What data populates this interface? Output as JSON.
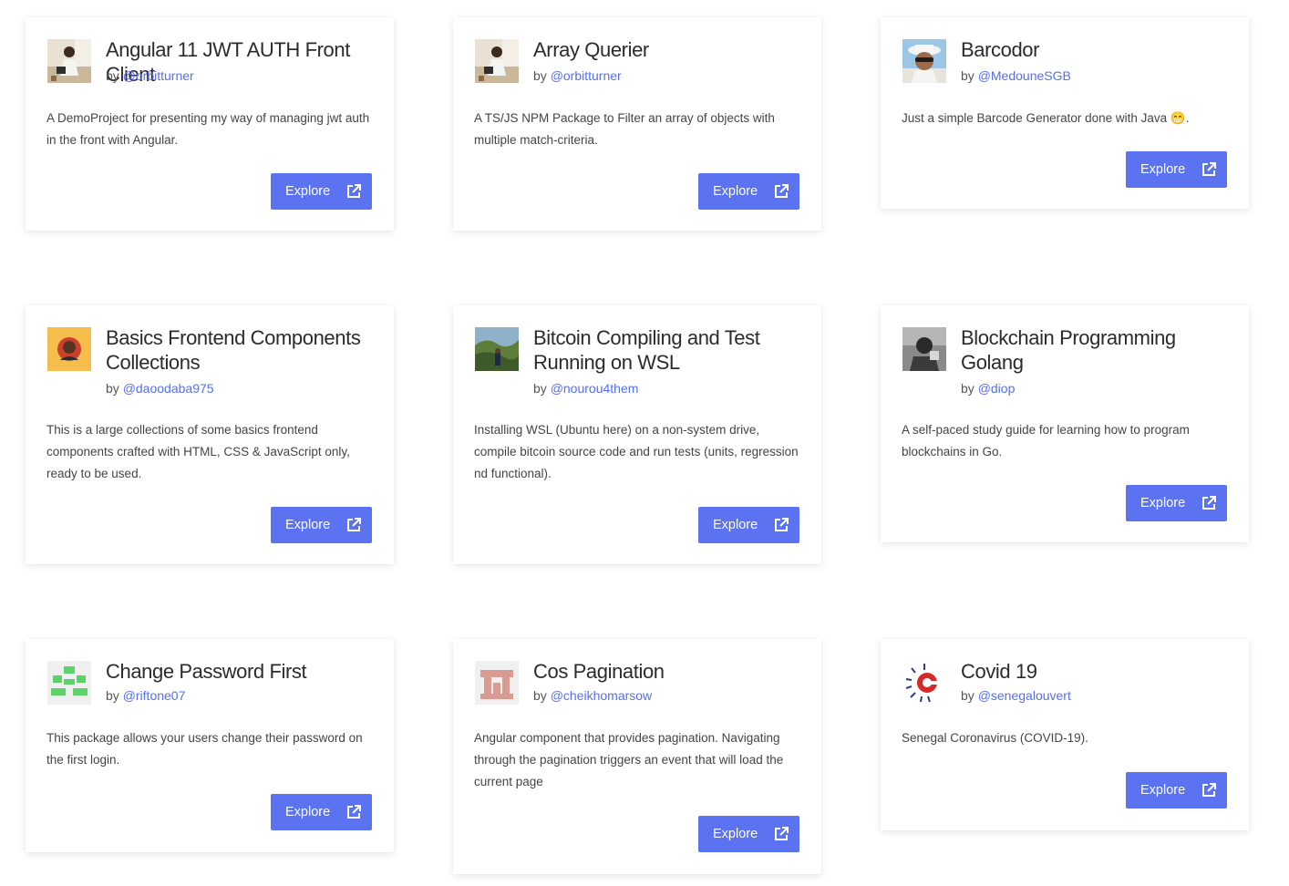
{
  "explore_label": "Explore",
  "accent_color": "#5b73f0",
  "cards": [
    {
      "title": "Angular 11 JWT AUTH Front Client",
      "by": "by",
      "handle": "@orbitturner",
      "description": "A DemoProject for presenting my way of managing jwt auth in the front with Angular.",
      "avatar": "photo-person-sitting"
    },
    {
      "title": "Array Querier",
      "by": "by",
      "handle": "@orbitturner",
      "description": "A TS/JS NPM Package to Filter an array of objects with multiple match-criteria.",
      "avatar": "photo-person-sitting"
    },
    {
      "title": "Barcodor",
      "by": "by",
      "handle": "@MedouneSGB",
      "description": "Just a simple Barcode Generator done with Java 😁.",
      "avatar": "photo-person-hat-sunglasses"
    },
    {
      "title": "Basics Frontend Components Collections",
      "by": "by",
      "handle": "@daoodaba975",
      "description": "This is a large collections of some basics frontend components crafted with HTML, CSS & JavaScript only, ready to be used.",
      "avatar": "photo-person-yellow-bg"
    },
    {
      "title": "Bitcoin Compiling and Test Running on WSL",
      "by": "by",
      "handle": "@nourou4them",
      "description": "Installing WSL (Ubuntu here) on a non-system drive, compile bitcoin source code and run tests (units, regression nd functional).",
      "avatar": "photo-person-landscape"
    },
    {
      "title": "Blockchain Programming Golang",
      "by": "by",
      "handle": "@diop",
      "description": "A self-paced study guide for learning how to program blockchains in Go.",
      "avatar": "photo-person-grayscale"
    },
    {
      "title": "Change Password First",
      "by": "by",
      "handle": "@riftone07",
      "description": "This package allows your users change their password on the first login.",
      "avatar": "identicon-green"
    },
    {
      "title": "Cos Pagination",
      "by": "by",
      "handle": "@cheikhomarsow",
      "description": "Angular component that provides pagination. Navigating through the pagination triggers an event that will load the current page",
      "avatar": "identicon-pink"
    },
    {
      "title": "Covid 19",
      "by": "by",
      "handle": "@senegalouvert",
      "description": "Senegal Coronavirus (COVID-19).",
      "avatar": "covid-logo"
    }
  ]
}
